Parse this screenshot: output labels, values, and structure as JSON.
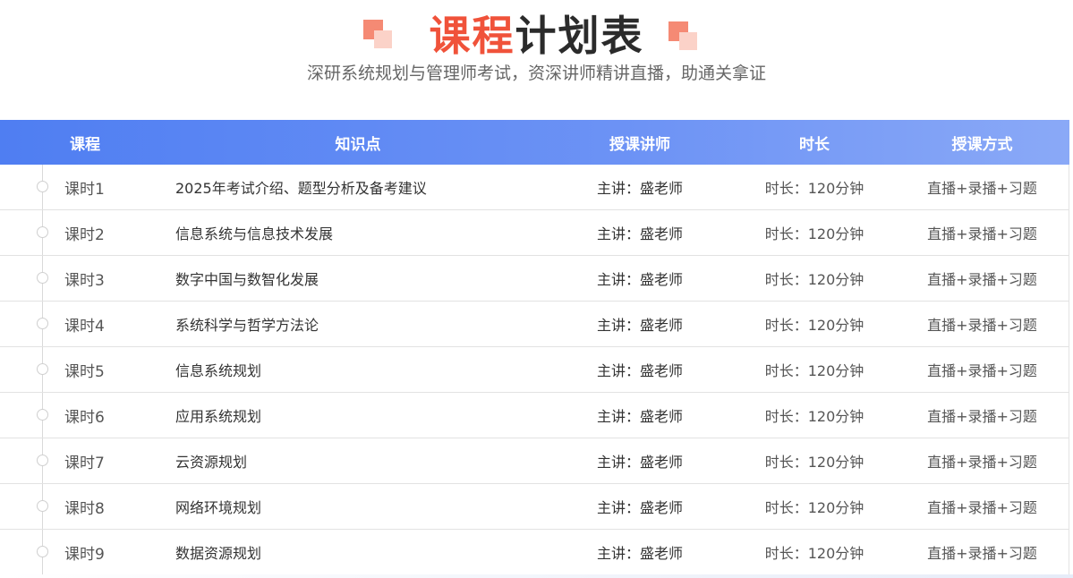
{
  "header": {
    "title_accent": "课程",
    "title_rest": "计划表",
    "subtitle": "深研系统规划与管理师考试，资深讲师精讲直播，助通关拿证"
  },
  "table": {
    "columns": [
      "课程",
      "知识点",
      "授课讲师",
      "时长",
      "授课方式"
    ],
    "rows": [
      {
        "lesson": "课时1",
        "topic": "2025年考试介绍、题型分析及备考建议",
        "teacher": "主讲：盛老师",
        "duration": "时长：120分钟",
        "mode": "直播+录播+习题"
      },
      {
        "lesson": "课时2",
        "topic": "信息系统与信息技术发展",
        "teacher": "主讲：盛老师",
        "duration": "时长：120分钟",
        "mode": "直播+录播+习题"
      },
      {
        "lesson": "课时3",
        "topic": "数字中国与数智化发展",
        "teacher": "主讲：盛老师",
        "duration": "时长：120分钟",
        "mode": "直播+录播+习题"
      },
      {
        "lesson": "课时4",
        "topic": "系统科学与哲学方法论",
        "teacher": "主讲：盛老师",
        "duration": "时长：120分钟",
        "mode": "直播+录播+习题"
      },
      {
        "lesson": "课时5",
        "topic": "信息系统规划",
        "teacher": "主讲：盛老师",
        "duration": "时长：120分钟",
        "mode": "直播+录播+习题"
      },
      {
        "lesson": "课时6",
        "topic": "应用系统规划",
        "teacher": "主讲：盛老师",
        "duration": "时长：120分钟",
        "mode": "直播+录播+习题"
      },
      {
        "lesson": "课时7",
        "topic": "云资源规划",
        "teacher": "主讲：盛老师",
        "duration": "时长：120分钟",
        "mode": "直播+录播+习题"
      },
      {
        "lesson": "课时8",
        "topic": "网络环境规划",
        "teacher": "主讲：盛老师",
        "duration": "时长：120分钟",
        "mode": "直播+录播+习题"
      },
      {
        "lesson": "课时9",
        "topic": "数据资源规划",
        "teacher": "主讲：盛老师",
        "duration": "时长：120分钟",
        "mode": "直播+录播+习题"
      }
    ]
  }
}
